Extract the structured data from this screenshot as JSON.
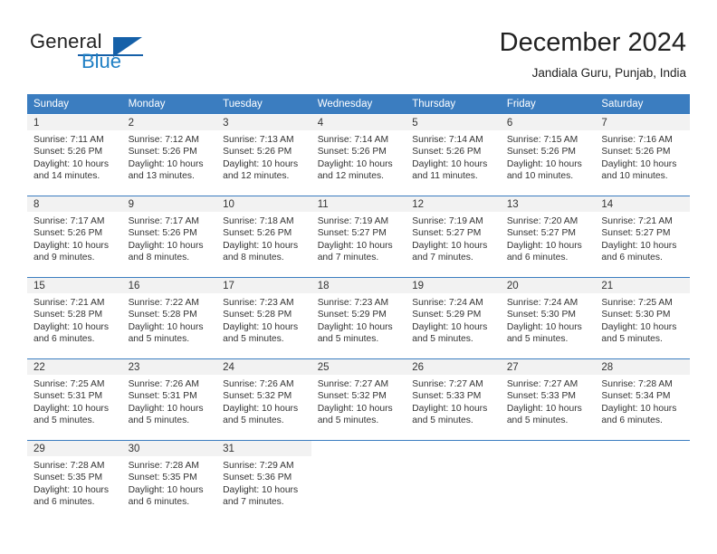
{
  "brand": {
    "name_part1": "General",
    "name_part2": "Blue",
    "logo_icon": "triangle-logo-icon",
    "accent_color": "#1560a8"
  },
  "header": {
    "title": "December 2024",
    "subtitle": "Jandiala Guru, Punjab, India"
  },
  "theme": {
    "header_row_bg": "#3b7dc0",
    "daynum_bg": "#f2f2f2",
    "text_color": "#333333"
  },
  "weekdays": [
    "Sunday",
    "Monday",
    "Tuesday",
    "Wednesday",
    "Thursday",
    "Friday",
    "Saturday"
  ],
  "weeks": [
    [
      {
        "day": "1",
        "sunrise": "Sunrise: 7:11 AM",
        "sunset": "Sunset: 5:26 PM",
        "daylight_line1": "Daylight: 10 hours",
        "daylight_line2": "and 14 minutes."
      },
      {
        "day": "2",
        "sunrise": "Sunrise: 7:12 AM",
        "sunset": "Sunset: 5:26 PM",
        "daylight_line1": "Daylight: 10 hours",
        "daylight_line2": "and 13 minutes."
      },
      {
        "day": "3",
        "sunrise": "Sunrise: 7:13 AM",
        "sunset": "Sunset: 5:26 PM",
        "daylight_line1": "Daylight: 10 hours",
        "daylight_line2": "and 12 minutes."
      },
      {
        "day": "4",
        "sunrise": "Sunrise: 7:14 AM",
        "sunset": "Sunset: 5:26 PM",
        "daylight_line1": "Daylight: 10 hours",
        "daylight_line2": "and 12 minutes."
      },
      {
        "day": "5",
        "sunrise": "Sunrise: 7:14 AM",
        "sunset": "Sunset: 5:26 PM",
        "daylight_line1": "Daylight: 10 hours",
        "daylight_line2": "and 11 minutes."
      },
      {
        "day": "6",
        "sunrise": "Sunrise: 7:15 AM",
        "sunset": "Sunset: 5:26 PM",
        "daylight_line1": "Daylight: 10 hours",
        "daylight_line2": "and 10 minutes."
      },
      {
        "day": "7",
        "sunrise": "Sunrise: 7:16 AM",
        "sunset": "Sunset: 5:26 PM",
        "daylight_line1": "Daylight: 10 hours",
        "daylight_line2": "and 10 minutes."
      }
    ],
    [
      {
        "day": "8",
        "sunrise": "Sunrise: 7:17 AM",
        "sunset": "Sunset: 5:26 PM",
        "daylight_line1": "Daylight: 10 hours",
        "daylight_line2": "and 9 minutes."
      },
      {
        "day": "9",
        "sunrise": "Sunrise: 7:17 AM",
        "sunset": "Sunset: 5:26 PM",
        "daylight_line1": "Daylight: 10 hours",
        "daylight_line2": "and 8 minutes."
      },
      {
        "day": "10",
        "sunrise": "Sunrise: 7:18 AM",
        "sunset": "Sunset: 5:26 PM",
        "daylight_line1": "Daylight: 10 hours",
        "daylight_line2": "and 8 minutes."
      },
      {
        "day": "11",
        "sunrise": "Sunrise: 7:19 AM",
        "sunset": "Sunset: 5:27 PM",
        "daylight_line1": "Daylight: 10 hours",
        "daylight_line2": "and 7 minutes."
      },
      {
        "day": "12",
        "sunrise": "Sunrise: 7:19 AM",
        "sunset": "Sunset: 5:27 PM",
        "daylight_line1": "Daylight: 10 hours",
        "daylight_line2": "and 7 minutes."
      },
      {
        "day": "13",
        "sunrise": "Sunrise: 7:20 AM",
        "sunset": "Sunset: 5:27 PM",
        "daylight_line1": "Daylight: 10 hours",
        "daylight_line2": "and 6 minutes."
      },
      {
        "day": "14",
        "sunrise": "Sunrise: 7:21 AM",
        "sunset": "Sunset: 5:27 PM",
        "daylight_line1": "Daylight: 10 hours",
        "daylight_line2": "and 6 minutes."
      }
    ],
    [
      {
        "day": "15",
        "sunrise": "Sunrise: 7:21 AM",
        "sunset": "Sunset: 5:28 PM",
        "daylight_line1": "Daylight: 10 hours",
        "daylight_line2": "and 6 minutes."
      },
      {
        "day": "16",
        "sunrise": "Sunrise: 7:22 AM",
        "sunset": "Sunset: 5:28 PM",
        "daylight_line1": "Daylight: 10 hours",
        "daylight_line2": "and 5 minutes."
      },
      {
        "day": "17",
        "sunrise": "Sunrise: 7:23 AM",
        "sunset": "Sunset: 5:28 PM",
        "daylight_line1": "Daylight: 10 hours",
        "daylight_line2": "and 5 minutes."
      },
      {
        "day": "18",
        "sunrise": "Sunrise: 7:23 AM",
        "sunset": "Sunset: 5:29 PM",
        "daylight_line1": "Daylight: 10 hours",
        "daylight_line2": "and 5 minutes."
      },
      {
        "day": "19",
        "sunrise": "Sunrise: 7:24 AM",
        "sunset": "Sunset: 5:29 PM",
        "daylight_line1": "Daylight: 10 hours",
        "daylight_line2": "and 5 minutes."
      },
      {
        "day": "20",
        "sunrise": "Sunrise: 7:24 AM",
        "sunset": "Sunset: 5:30 PM",
        "daylight_line1": "Daylight: 10 hours",
        "daylight_line2": "and 5 minutes."
      },
      {
        "day": "21",
        "sunrise": "Sunrise: 7:25 AM",
        "sunset": "Sunset: 5:30 PM",
        "daylight_line1": "Daylight: 10 hours",
        "daylight_line2": "and 5 minutes."
      }
    ],
    [
      {
        "day": "22",
        "sunrise": "Sunrise: 7:25 AM",
        "sunset": "Sunset: 5:31 PM",
        "daylight_line1": "Daylight: 10 hours",
        "daylight_line2": "and 5 minutes."
      },
      {
        "day": "23",
        "sunrise": "Sunrise: 7:26 AM",
        "sunset": "Sunset: 5:31 PM",
        "daylight_line1": "Daylight: 10 hours",
        "daylight_line2": "and 5 minutes."
      },
      {
        "day": "24",
        "sunrise": "Sunrise: 7:26 AM",
        "sunset": "Sunset: 5:32 PM",
        "daylight_line1": "Daylight: 10 hours",
        "daylight_line2": "and 5 minutes."
      },
      {
        "day": "25",
        "sunrise": "Sunrise: 7:27 AM",
        "sunset": "Sunset: 5:32 PM",
        "daylight_line1": "Daylight: 10 hours",
        "daylight_line2": "and 5 minutes."
      },
      {
        "day": "26",
        "sunrise": "Sunrise: 7:27 AM",
        "sunset": "Sunset: 5:33 PM",
        "daylight_line1": "Daylight: 10 hours",
        "daylight_line2": "and 5 minutes."
      },
      {
        "day": "27",
        "sunrise": "Sunrise: 7:27 AM",
        "sunset": "Sunset: 5:33 PM",
        "daylight_line1": "Daylight: 10 hours",
        "daylight_line2": "and 5 minutes."
      },
      {
        "day": "28",
        "sunrise": "Sunrise: 7:28 AM",
        "sunset": "Sunset: 5:34 PM",
        "daylight_line1": "Daylight: 10 hours",
        "daylight_line2": "and 6 minutes."
      }
    ],
    [
      {
        "day": "29",
        "sunrise": "Sunrise: 7:28 AM",
        "sunset": "Sunset: 5:35 PM",
        "daylight_line1": "Daylight: 10 hours",
        "daylight_line2": "and 6 minutes."
      },
      {
        "day": "30",
        "sunrise": "Sunrise: 7:28 AM",
        "sunset": "Sunset: 5:35 PM",
        "daylight_line1": "Daylight: 10 hours",
        "daylight_line2": "and 6 minutes."
      },
      {
        "day": "31",
        "sunrise": "Sunrise: 7:29 AM",
        "sunset": "Sunset: 5:36 PM",
        "daylight_line1": "Daylight: 10 hours",
        "daylight_line2": "and 7 minutes."
      },
      {
        "day": "",
        "sunrise": "",
        "sunset": "",
        "daylight_line1": "",
        "daylight_line2": ""
      },
      {
        "day": "",
        "sunrise": "",
        "sunset": "",
        "daylight_line1": "",
        "daylight_line2": ""
      },
      {
        "day": "",
        "sunrise": "",
        "sunset": "",
        "daylight_line1": "",
        "daylight_line2": ""
      },
      {
        "day": "",
        "sunrise": "",
        "sunset": "",
        "daylight_line1": "",
        "daylight_line2": ""
      }
    ]
  ]
}
